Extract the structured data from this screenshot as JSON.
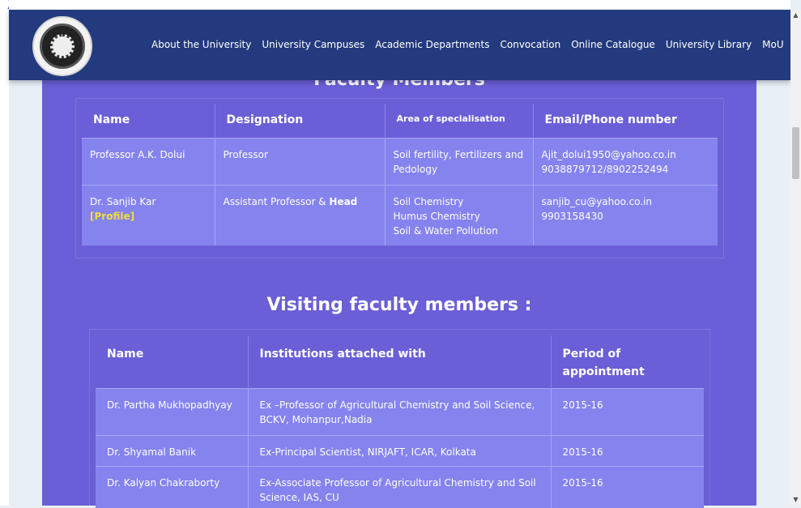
{
  "header": {
    "logo_text": "UNIVERSITY OF CALCUTTA · ADVANCEMENT OF LEARNING",
    "nav": [
      "About the University",
      "University Campuses",
      "Academic Departments",
      "Convocation",
      "Online Catalogue",
      "University Library",
      "MoU"
    ]
  },
  "faculty": {
    "heading": "Faculty Members",
    "columns": [
      "Name",
      "Designation",
      "Area of specialisation",
      "Email/Phone number"
    ],
    "rows": [
      {
        "name": "Professor A.K. Dolui",
        "profile": "",
        "designation": "Professor",
        "designation_bold": "",
        "area": [
          "Soil fertility, Fertilizers and Pedology"
        ],
        "contact": [
          "Ajit_dolui1950@yahoo.co.in",
          "9038879712/8902252494"
        ]
      },
      {
        "name": "Dr. Sanjib Kar",
        "profile": "[Profile]",
        "designation": "Assistant Professor & ",
        "designation_bold": "Head",
        "area": [
          "Soil Chemistry",
          "Humus Chemistry",
          "Soil & Water Pollution"
        ],
        "contact": [
          "sanjib_cu@yahoo.co.in",
          "9903158430"
        ]
      }
    ]
  },
  "visiting": {
    "heading": "Visiting faculty members :",
    "columns": [
      "Name",
      "Institutions attached with",
      "Period of appointment"
    ],
    "rows": [
      {
        "name": "Dr. Partha Mukhopadhyay",
        "institution": "Ex –Professor of Agricultural Chemistry and Soil Science, BCKV,  Mohanpur,Nadia",
        "period": "2015-16"
      },
      {
        "name": "Dr. Shyamal Banik",
        "institution": "Ex-Principal Scientist, NIRJAFT, ICAR, Kolkata",
        "period": "2015-16"
      },
      {
        "name": "Dr. Kalyan Chakraborty",
        "institution": "Ex-Associate Professor of Agricultural Chemistry and Soil Science, IAS, CU",
        "period": "2015-16"
      }
    ]
  },
  "colors": {
    "header_bg": "#233a7e",
    "page_bg": "#6a5fd7",
    "row_bg": "#8583ee",
    "profile_link": "#f1de36"
  }
}
